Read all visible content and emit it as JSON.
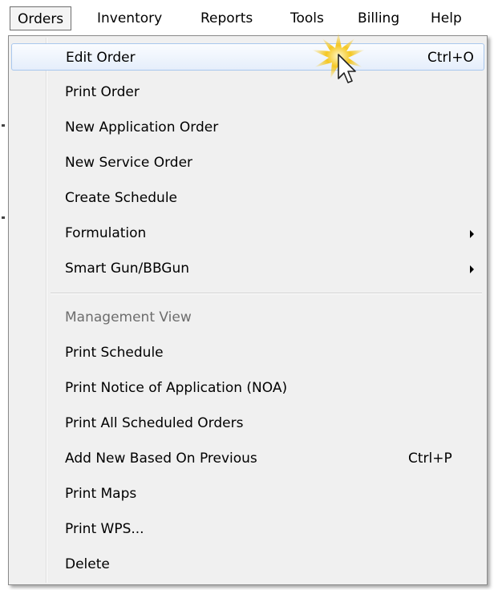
{
  "menubar": {
    "items": [
      {
        "label": "Orders",
        "active": true
      },
      {
        "label": "Inventory"
      },
      {
        "label": "Reports"
      },
      {
        "label": "Tools"
      },
      {
        "label": "Billing"
      },
      {
        "label": "Help"
      }
    ]
  },
  "dropdown": {
    "items": [
      {
        "label": "Edit Order",
        "shortcut": "Ctrl+O",
        "highlighted": true
      },
      {
        "label": "Print Order"
      },
      {
        "label": "New Application Order"
      },
      {
        "label": "New Service Order"
      },
      {
        "label": "Create Schedule"
      },
      {
        "label": "Formulation",
        "submenu": true
      },
      {
        "label": "Smart Gun/BBGun",
        "submenu": true
      },
      {
        "label": "Management View",
        "disabled": true
      },
      {
        "label": "Print Schedule"
      },
      {
        "label": "Print Notice of Application (NOA)"
      },
      {
        "label": "Print All Scheduled Orders"
      },
      {
        "label": "Add New Based On Previous",
        "shortcut": "Ctrl+P"
      },
      {
        "label": "Print Maps"
      },
      {
        "label": "Print WPS..."
      },
      {
        "label": "Delete"
      }
    ]
  },
  "colors": {
    "highlight_border": "#a8c7ee",
    "menu_background": "#f0f0f0",
    "disabled_text": "#6d6d6d",
    "cursor_glow": "#f5c518"
  }
}
